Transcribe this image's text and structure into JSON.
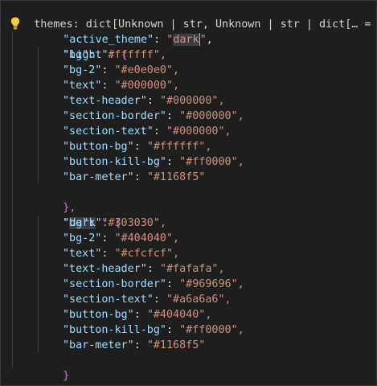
{
  "header": {
    "text": "themes: dict[Unknown | str, Unknown | str | dict[… = ",
    "brace": "{"
  },
  "active_theme": {
    "key": "\"active_theme\"",
    "colon": ": ",
    "value_open": "\"",
    "value_text": "dark",
    "value_close": "\"",
    "comma": ","
  },
  "light": {
    "key": "\"light\"",
    "open": ": {",
    "close": "},",
    "entries": [
      {
        "key": "\"bg\"",
        "value": "\"#ffffff\","
      },
      {
        "key": "\"bg-2\"",
        "value": "\"#e0e0e0\","
      },
      {
        "key": "\"text\"",
        "value": "\"#000000\","
      },
      {
        "key": "\"text-header\"",
        "value": "\"#000000\","
      },
      {
        "key": "\"section-border\"",
        "value": "\"#000000\","
      },
      {
        "key": "\"section-text\"",
        "value": "\"#000000\","
      },
      {
        "key": "\"button-bg\"",
        "value": "\"#ffffff\","
      },
      {
        "key": "\"button-kill-bg\"",
        "value": "\"#ff0000\","
      },
      {
        "key": "\"bar-meter\"",
        "value": "\"#1168f5\""
      }
    ]
  },
  "dark": {
    "key_open": "\"",
    "key_text": "dark",
    "key_close": "\"",
    "open": ": {",
    "close": "}",
    "entries": [
      {
        "key": "\"bg\"",
        "value": "\"#303030\","
      },
      {
        "key": "\"bg-2\"",
        "value": "\"#404040\","
      },
      {
        "key": "\"text\"",
        "value": "\"#cfcfcf\","
      },
      {
        "key": "\"text-header\"",
        "value": "\"#fafafa\","
      },
      {
        "key": "\"section-border\"",
        "value": "\"#969696\","
      },
      {
        "key": "\"section-text\"",
        "value": "\"#a6a6a6\","
      },
      {
        "key": "\"button-bg\"",
        "value": "\"#404040\","
      },
      {
        "key": "\"button-kill-bg\"",
        "value": "\"#ff0000\","
      },
      {
        "key": "\"bar-meter\"",
        "value": "\"#1168f5\""
      }
    ]
  },
  "closing_brace": "}",
  "icons": {
    "lightbulb": "lightbulb-icon"
  },
  "colors": {
    "background": "#1f1f1f",
    "key": "#9cdcfe",
    "string": "#ce9178",
    "bracket_level1": "#e0c02a",
    "bracket_level2": "#c879d2",
    "bracket_level3": "#4ba0e6"
  }
}
